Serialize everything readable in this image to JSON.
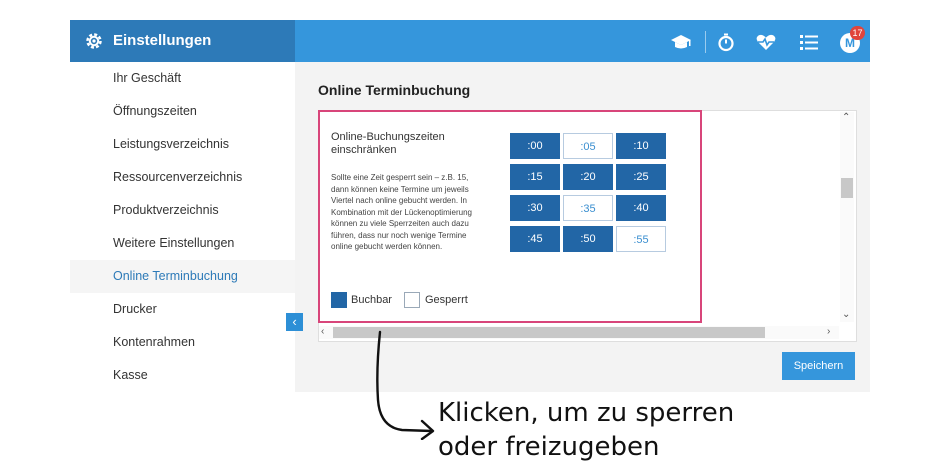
{
  "sidebar": {
    "title": "Einstellungen",
    "items": [
      {
        "label": "Ihr Geschäft"
      },
      {
        "label": "Öffnungszeiten"
      },
      {
        "label": "Leistungsverzeichnis"
      },
      {
        "label": "Ressourcenverzeichnis"
      },
      {
        "label": "Produktverzeichnis"
      },
      {
        "label": "Weitere Einstellungen"
      },
      {
        "label": "Online Terminbuchung"
      },
      {
        "label": "Drucker"
      },
      {
        "label": "Kontenrahmen"
      },
      {
        "label": "Kasse"
      }
    ],
    "active_index": 6,
    "collapse_icon": "chevron-left-icon"
  },
  "topbar": {
    "icons": [
      "graduation-cap-icon",
      "stopwatch-icon",
      "heartbeat-icon",
      "list-icon"
    ],
    "avatar_initial": "M",
    "notification_count": "17"
  },
  "main": {
    "title": "Online Terminbuchung",
    "setting_label": "Online-Buchungszeiten einschränken",
    "setting_description": "Sollte eine Zeit gesperrt sein – z.B. 15, dann können keine Termine um jeweils Viertel nach online gebucht werden. In Kombination mit der Lückenoptimierung können zu viele Sperrzeiten auch dazu führen, dass nur noch wenige Termine online gebucht werden können.",
    "slots": [
      {
        "label": ":00",
        "state": "free"
      },
      {
        "label": ":05",
        "state": "blocked"
      },
      {
        "label": ":10",
        "state": "free"
      },
      {
        "label": ":15",
        "state": "free"
      },
      {
        "label": ":20",
        "state": "free"
      },
      {
        "label": ":25",
        "state": "free"
      },
      {
        "label": ":30",
        "state": "free"
      },
      {
        "label": ":35",
        "state": "blocked"
      },
      {
        "label": ":40",
        "state": "free"
      },
      {
        "label": ":45",
        "state": "free"
      },
      {
        "label": ":50",
        "state": "free"
      },
      {
        "label": ":55",
        "state": "blocked"
      }
    ],
    "legend": {
      "free_label": "Buchbar",
      "blocked_label": "Gesperrt"
    },
    "save_label": "Speichern"
  },
  "annotation": {
    "line1": "Klicken, um zu sperren",
    "line2": "oder freizugeben"
  },
  "colors": {
    "sidebar_header": "#2d7ab8",
    "topbar": "#3596dc",
    "slot_free": "#2266a6",
    "highlight_border": "#d8457a",
    "badge": "#e0453c"
  }
}
